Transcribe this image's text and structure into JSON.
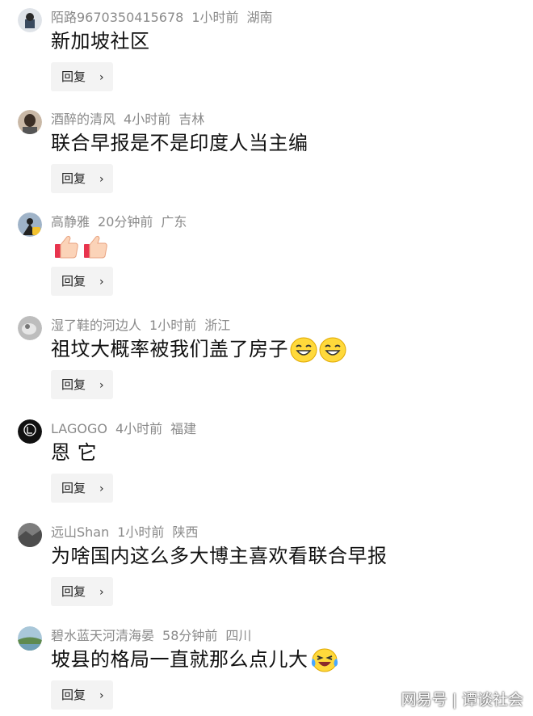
{
  "reply_label": "回复",
  "comments": [
    {
      "user": "陌路9670350415678",
      "time": "1小时前",
      "region": "湖南",
      "text": "新加坡社区"
    },
    {
      "user": "酒醉的清风",
      "time": "4小时前",
      "region": "吉林",
      "text": "联合早报是不是印度人当主编"
    },
    {
      "user": "高静雅",
      "time": "20分钟前",
      "region": "广东",
      "text": ""
    },
    {
      "user": "湿了鞋的河边人",
      "time": "1小时前",
      "region": "浙江",
      "text": "祖坟大概率被我们盖了房子"
    },
    {
      "user": "LAGOGO",
      "time": "4小时前",
      "region": "福建",
      "text": "恩 它"
    },
    {
      "user": "远山Shan",
      "time": "1小时前",
      "region": "陕西",
      "text": "为啥国内这么多大博主喜欢看联合早报"
    },
    {
      "user": "碧水蓝天河清海晏",
      "time": "58分钟前",
      "region": "四川",
      "text": "坡县的格局一直就那么点儿大"
    }
  ],
  "watermark": {
    "source": "网易号",
    "author": "谭谈社会"
  }
}
